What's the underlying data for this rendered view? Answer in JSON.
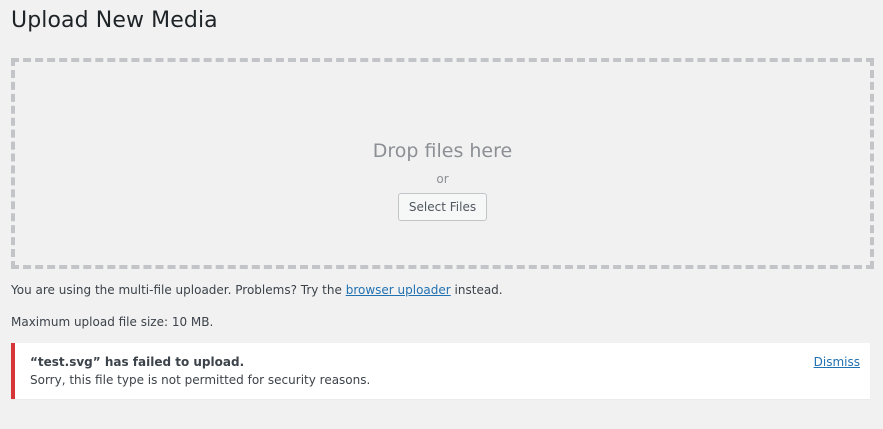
{
  "page": {
    "title": "Upload New Media"
  },
  "drop_zone": {
    "title": "Drop files here",
    "or": "or",
    "select_button": "Select Files"
  },
  "uploader_info": {
    "prefix": "You are using the multi-file uploader. Problems? Try the",
    "link": "browser uploader",
    "suffix": "instead."
  },
  "max_size": "Maximum upload file size: 10 MB.",
  "error_notice": {
    "title": "“test.svg” has failed to upload.",
    "message": "Sorry, this file type is not permitted for security reasons.",
    "dismiss": "Dismiss",
    "accent_color": "#d63638"
  },
  "colors": {
    "link": "#2271b1",
    "background": "#f1f1f1",
    "drop_border": "#c3c4c7"
  }
}
